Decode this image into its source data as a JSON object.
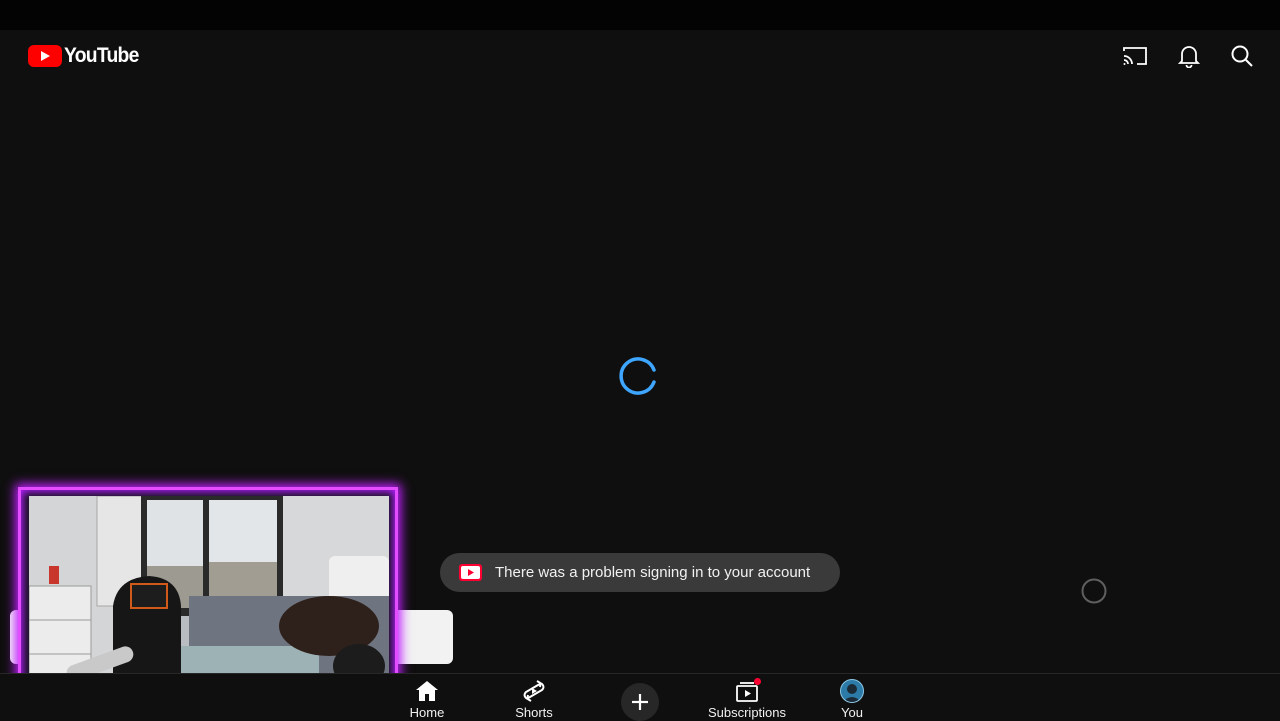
{
  "app": {
    "logo_text": "YouTube"
  },
  "header": {
    "actions": [
      {
        "name": "cast-icon"
      },
      {
        "name": "notifications-bell-icon"
      },
      {
        "name": "search-icon"
      }
    ]
  },
  "toast": {
    "message": "There was a problem signing in to your account"
  },
  "bottom_nav": {
    "items": [
      {
        "label": "Home",
        "icon": "home-icon"
      },
      {
        "label": "Shorts",
        "icon": "shorts-icon"
      },
      {
        "label": "",
        "icon": "plus-icon"
      },
      {
        "label": "Subscriptions",
        "icon": "subscriptions-icon"
      },
      {
        "label": "You",
        "icon": "avatar"
      }
    ]
  },
  "colors": {
    "background": "#0f0f0f",
    "brand_red": "#ff0000",
    "spinner_blue": "#3ea6ff",
    "webcam_border": "#e34dff",
    "toast_background": "#3a3a3a"
  }
}
